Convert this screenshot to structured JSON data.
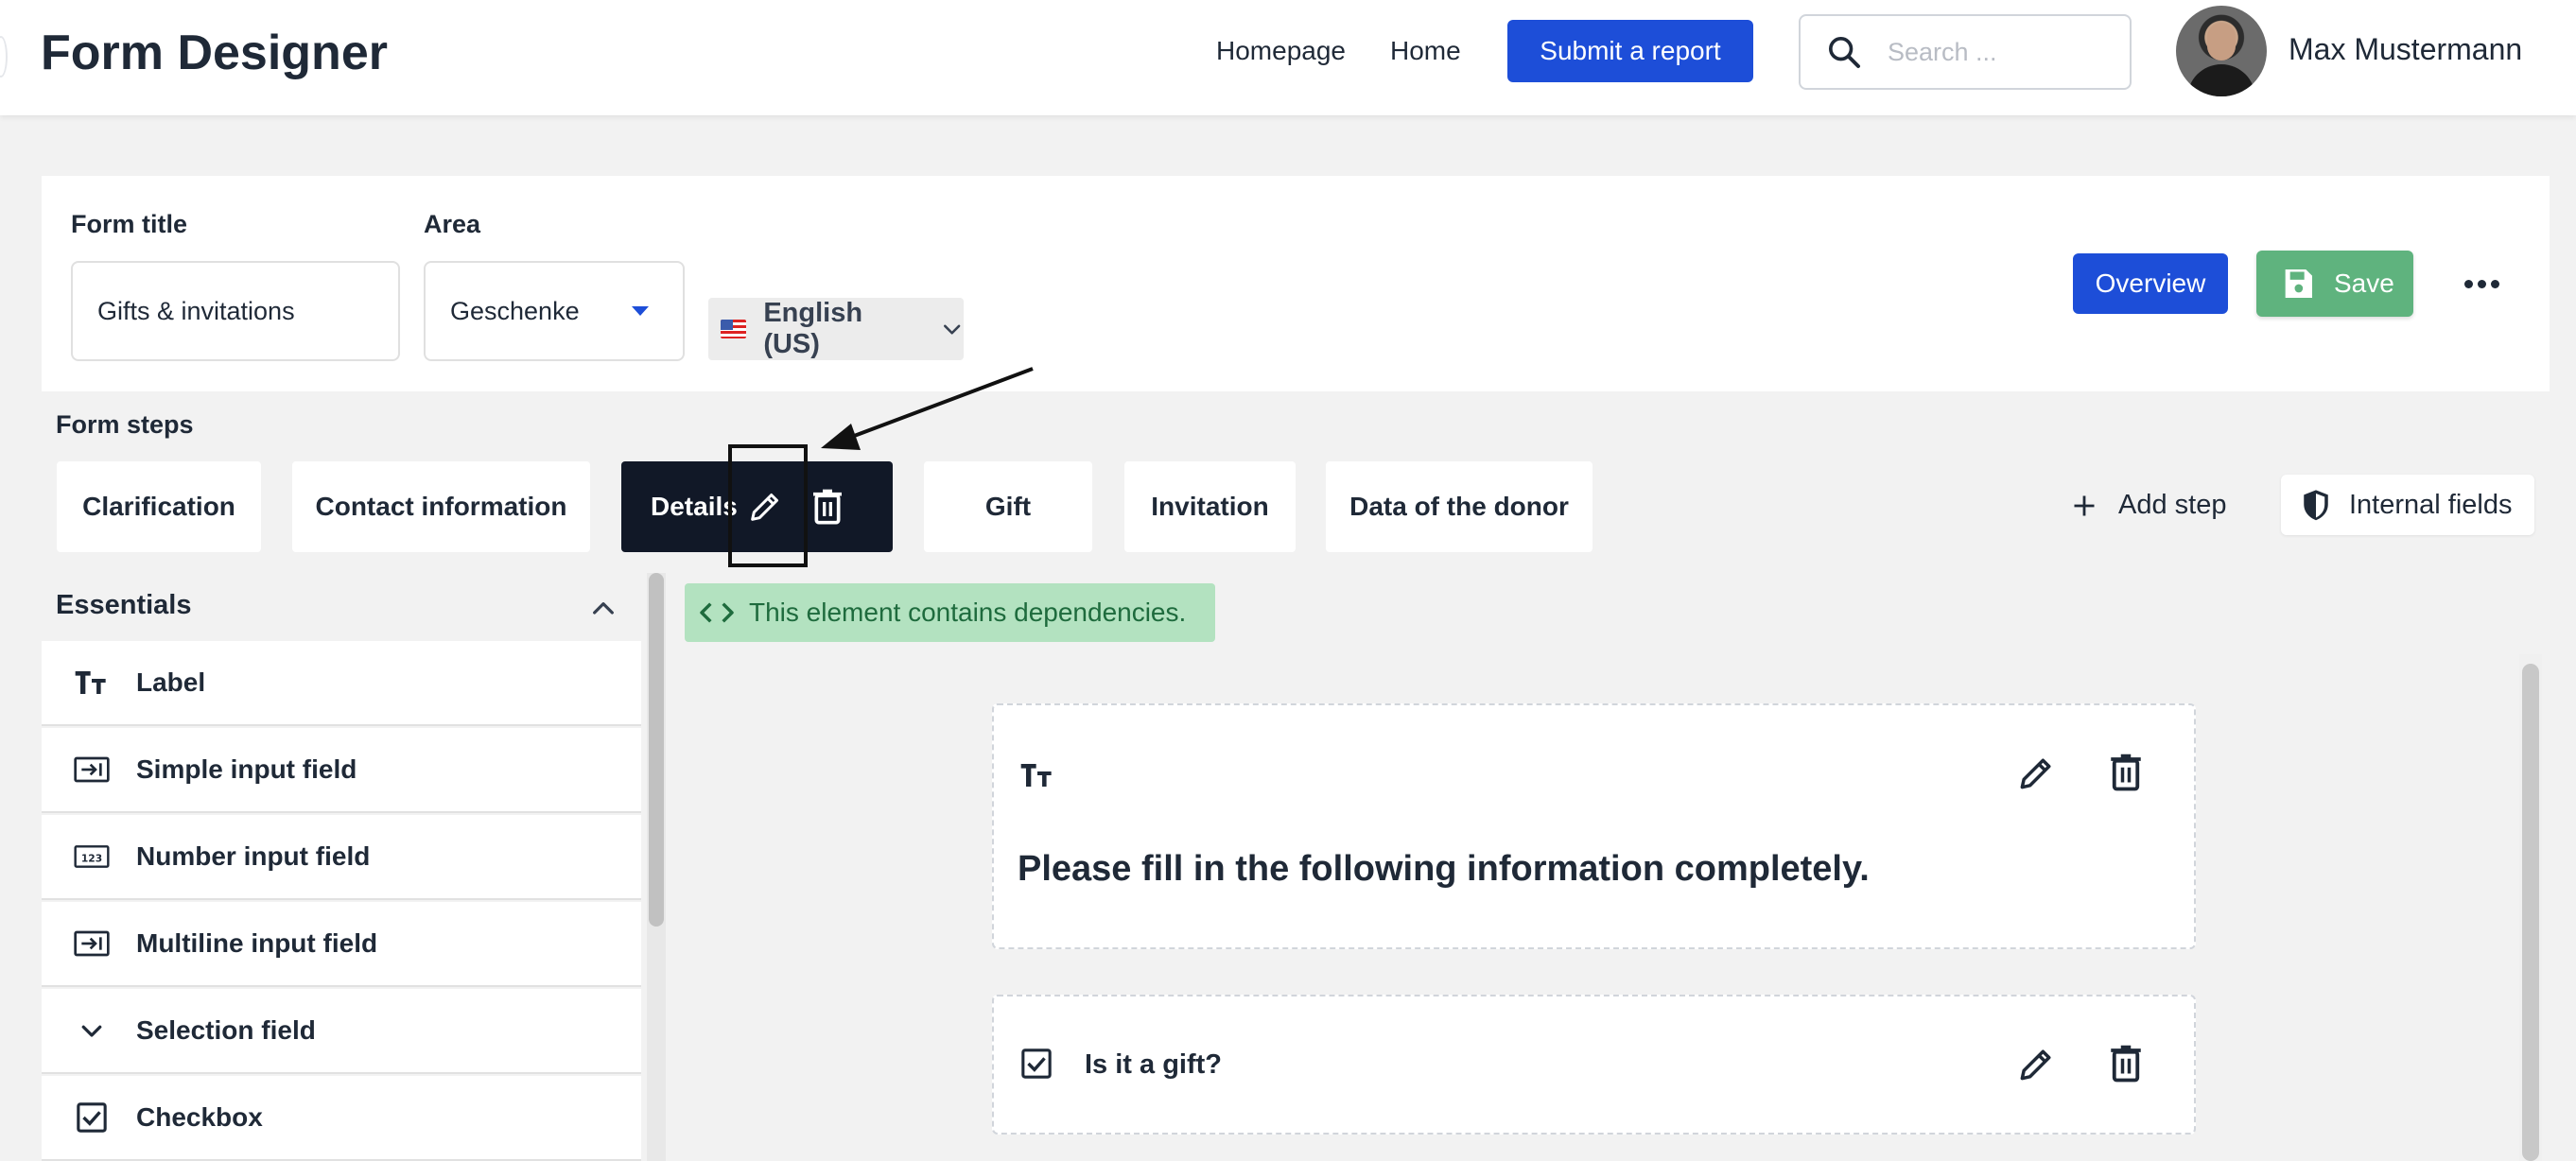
{
  "app": {
    "title": "Form Designer"
  },
  "nav": {
    "links": [
      "Homepage",
      "Home"
    ],
    "submit_label": "Submit a report"
  },
  "search": {
    "placeholder": "Search ...",
    "value": ""
  },
  "user": {
    "name": "Max Mustermann"
  },
  "form": {
    "title_label": "Form title",
    "title_value": "Gifts & invitations",
    "area_label": "Area",
    "area_value": "Geschenke",
    "language": "English (US)",
    "overview_label": "Overview",
    "save_label": "Save"
  },
  "steps": {
    "label": "Form steps",
    "items": [
      "Clarification",
      "Contact information",
      "Details",
      "Gift",
      "Invitation",
      "Data of the donor"
    ],
    "active_index": 2,
    "add_label": "Add step",
    "internal_label": "Internal fields"
  },
  "sidebar": {
    "section": "Essentials",
    "items": [
      {
        "label": "Label",
        "icon": "text-type-icon"
      },
      {
        "label": "Simple input field",
        "icon": "input-arrow-icon"
      },
      {
        "label": "Number input field",
        "icon": "number-123-icon"
      },
      {
        "label": "Multiline input field",
        "icon": "input-arrow-icon"
      },
      {
        "label": "Selection field",
        "icon": "chevron-down-icon"
      },
      {
        "label": "Checkbox",
        "icon": "checkbox-icon"
      }
    ]
  },
  "canvas": {
    "dependency_notice": "This element contains dependencies.",
    "elements": [
      {
        "type": "label",
        "text": "Please fill in the following information completely."
      },
      {
        "type": "checkbox",
        "text": "Is it a gift?"
      }
    ]
  },
  "colors": {
    "primary": "#1d4ed8",
    "save": "#5fb37e",
    "active_step": "#111827",
    "dependency_bg": "#b3e2c0",
    "dependency_text": "#1e6b3d"
  }
}
